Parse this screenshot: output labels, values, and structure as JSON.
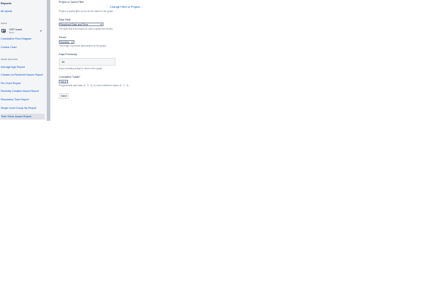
{
  "sidebar": {
    "title": "Reports",
    "all_reports": "All reports",
    "agile_section": "AGILE",
    "board": {
      "name": "SSP board",
      "type": "Board"
    },
    "agile_items": [
      {
        "label": "Cumulative Flow Diagram"
      },
      {
        "label": "Control Chart"
      }
    ],
    "issue_section": "ISSUE ANALYSIS",
    "issue_items": [
      {
        "label": "Average Age Report"
      },
      {
        "label": "Created vs Resolved Issues Report"
      },
      {
        "label": "Pie Chart Report"
      },
      {
        "label": "Recently Created Issues Report"
      },
      {
        "label": "Resolution Time Report"
      },
      {
        "label": "Single Level Group By Report"
      },
      {
        "label": "Time Since Issues Report"
      }
    ]
  },
  "form": {
    "filter": {
      "label": "Project or Saved Filter",
      "change_link": "Change Filter or Project...",
      "help": "Project or saved filter to use as the basis for the graph."
    },
    "date_field": {
      "label": "Date Field",
      "value": "Resolved Date and Time",
      "help": "The date field that should be used to graph the issues."
    },
    "period": {
      "label": "Period",
      "value": "Monthly",
      "help": "The length of periods represented on the graph."
    },
    "days_previously": {
      "label": "Days Previously",
      "value": "30",
      "help": "Days (including today) to show in the graph."
    },
    "cumulative": {
      "label": "Cumulative Totals?",
      "value": "Yes",
      "help": "Progressively add totals (1...2...3), or show individual values (1...1...1)."
    },
    "next_label": "Next"
  }
}
